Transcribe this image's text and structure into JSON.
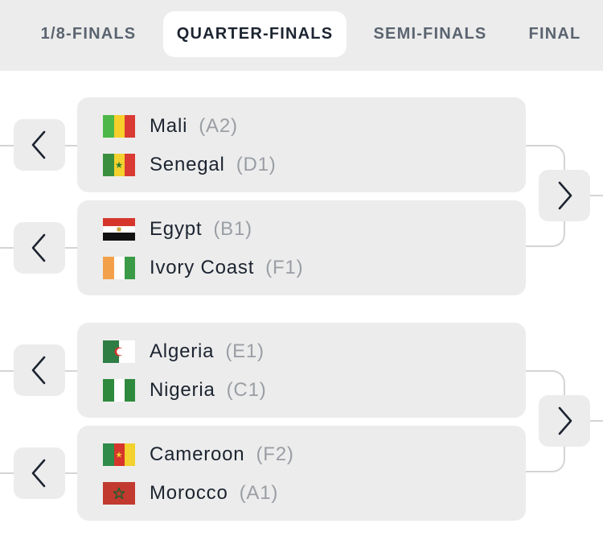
{
  "tabs": [
    {
      "label": "1/8-FINALS",
      "active": false
    },
    {
      "label": "QUARTER-FINALS",
      "active": true
    },
    {
      "label": "SEMI-FINALS",
      "active": false
    },
    {
      "label": "FINAL",
      "active": false
    }
  ],
  "matches": [
    {
      "team1": {
        "name": "Mali",
        "group": "(A2)",
        "flag": "mali-flag"
      },
      "team2": {
        "name": "Senegal",
        "group": "(D1)",
        "flag": "senegal-flag"
      }
    },
    {
      "team1": {
        "name": "Egypt",
        "group": "(B1)",
        "flag": "egypt-flag"
      },
      "team2": {
        "name": "Ivory Coast",
        "group": "(F1)",
        "flag": "ivory-coast-flag"
      }
    },
    {
      "team1": {
        "name": "Algeria",
        "group": "(E1)",
        "flag": "algeria-flag"
      },
      "team2": {
        "name": "Nigeria",
        "group": "(C1)",
        "flag": "nigeria-flag"
      }
    },
    {
      "team1": {
        "name": "Cameroon",
        "group": "(F2)",
        "flag": "cameroon-flag"
      },
      "team2": {
        "name": "Morocco",
        "group": "(A1)",
        "flag": "morocco-flag"
      }
    }
  ],
  "icons": {
    "previous": "chevron-left-icon",
    "next": "chevron-right-icon"
  },
  "colors": {
    "background": "#ffffff",
    "tab_bar": "#ececec",
    "card": "#ececec",
    "text": "#1c2430",
    "group_text": "#9a9ea4",
    "connector": "#d4d4d4"
  }
}
